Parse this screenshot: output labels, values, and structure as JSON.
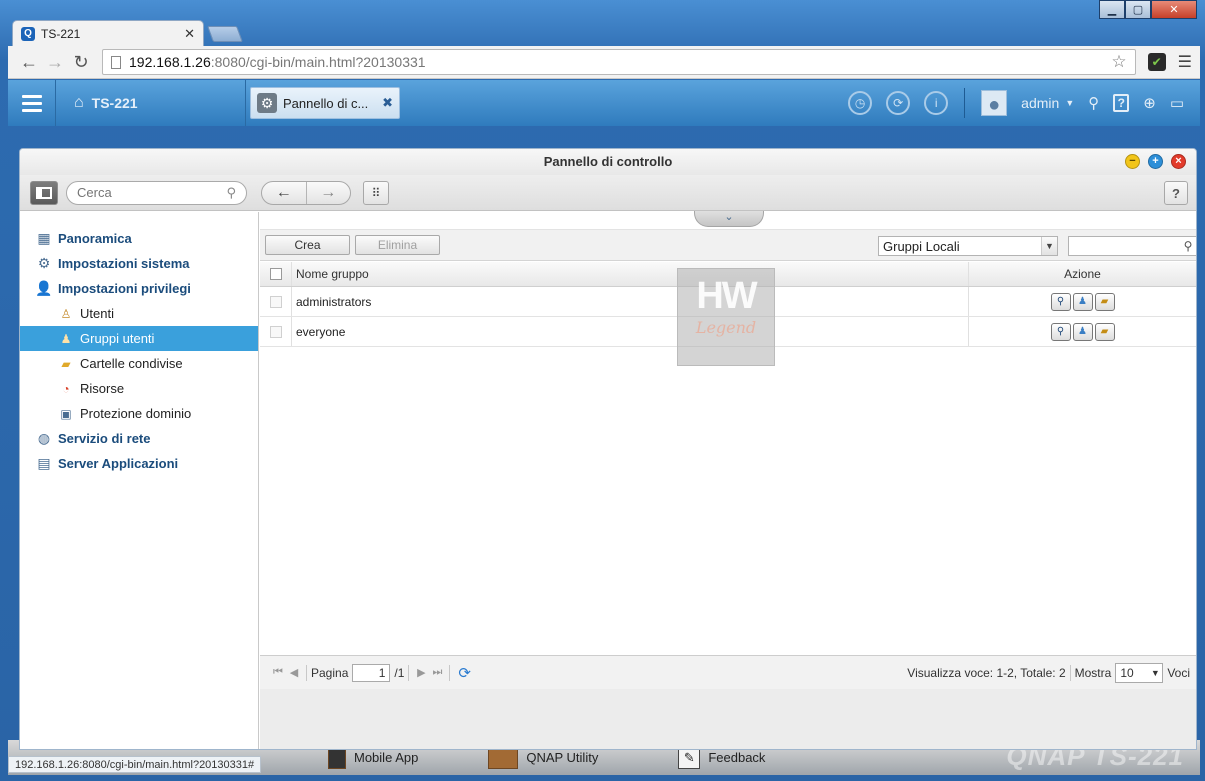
{
  "browser": {
    "tab_title": "TS-221",
    "tab_favicon": "Q",
    "url_host": "192.168.1.26",
    "url_rest": ":8080/cgi-bin/main.html?20130331",
    "status_url": "192.168.1.26:8080/cgi-bin/main.html?20130331#"
  },
  "qts": {
    "home_label": "TS-221",
    "app_tab_label": "Pannello di c...",
    "username": "admin"
  },
  "window": {
    "title": "Pannello di controllo"
  },
  "toolbar": {
    "search_placeholder": "Cerca"
  },
  "sidebar": {
    "items": [
      {
        "label": "Panoramica",
        "icon": "overview-icon",
        "level": 1
      },
      {
        "label": "Impostazioni sistema",
        "icon": "gear-icon",
        "level": 1
      },
      {
        "label": "Impostazioni privilegi",
        "icon": "user-icon",
        "level": 1
      },
      {
        "label": "Utenti",
        "icon": "single-user-icon",
        "level": 2
      },
      {
        "label": "Gruppi utenti",
        "icon": "user-group-icon",
        "level": 2,
        "active": true
      },
      {
        "label": "Cartelle condivise",
        "icon": "shared-folder-icon",
        "level": 2
      },
      {
        "label": "Risorse",
        "icon": "quota-icon",
        "level": 2
      },
      {
        "label": "Protezione dominio",
        "icon": "domain-icon",
        "level": 2
      },
      {
        "label": "Servizio di rete",
        "icon": "network-icon",
        "level": 1
      },
      {
        "label": "Server Applicazioni",
        "icon": "app-server-icon",
        "level": 1
      }
    ]
  },
  "actions": {
    "create_label": "Crea",
    "delete_label": "Elimina",
    "group_filter_value": "Gruppi Locali"
  },
  "table": {
    "columns": [
      "Nome gruppo",
      "Azione"
    ],
    "rows": [
      {
        "name": "administrators"
      },
      {
        "name": "everyone"
      }
    ]
  },
  "watermark": {
    "line1": "HW",
    "line2": "Legend"
  },
  "pager": {
    "page_label": "Pagina",
    "current_page": "1",
    "total_pages": "/1",
    "summary": "Visualizza voce: 1-2, Totale: 2",
    "show_label": "Mostra",
    "per_page": "10",
    "items_label": "Voci"
  },
  "desktop_strip": {
    "items": [
      "Mobile App",
      "QNAP Utility",
      "Feedback"
    ],
    "brand": "QNAP TS-221"
  }
}
